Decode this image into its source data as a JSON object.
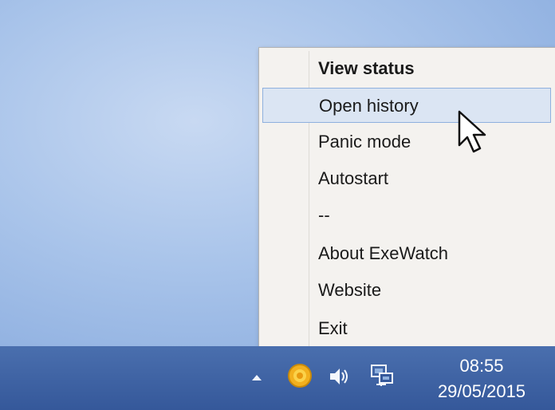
{
  "context_menu": {
    "items": [
      {
        "label": "View status",
        "bold": true
      },
      {
        "label": "Open history",
        "hovered": true
      },
      {
        "label": "Panic mode"
      },
      {
        "label": "Autostart"
      },
      {
        "label": "--"
      },
      {
        "label": "About ExeWatch"
      },
      {
        "label": "Website"
      },
      {
        "label": "Exit"
      }
    ]
  },
  "taskbar": {
    "tray_icons": [
      "show-hidden-icons-chevron",
      "exewatch-app-icon",
      "speaker-icon",
      "network-icon"
    ],
    "clock": {
      "time": "08:55",
      "date": "29/05/2015"
    }
  },
  "colors": {
    "desktop": "#a9c4ea",
    "taskbar": "#4a6fae",
    "menu_background": "#f4f2ef",
    "hover_highlight": "#dbe5f3",
    "app_icon": "#f2b01e"
  }
}
